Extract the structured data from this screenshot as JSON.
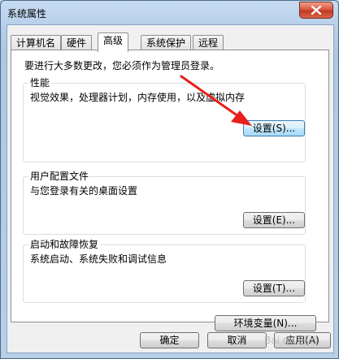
{
  "window": {
    "title": "系统属性"
  },
  "tabs": [
    {
      "label": "计算机名",
      "active": false
    },
    {
      "label": "硬件",
      "active": false
    },
    {
      "label": "高级",
      "active": true
    },
    {
      "label": "系统保护",
      "active": false
    },
    {
      "label": "远程",
      "active": false
    }
  ],
  "intro_text": "要进行大多数更改，您必须作为管理员登录。",
  "groups": {
    "performance": {
      "title": "性能",
      "description": "视觉效果，处理器计划，内存使用，以及虚拟内存",
      "button": "设置(S)..."
    },
    "user_profiles": {
      "title": "用户配置文件",
      "description": "与您登录有关的桌面设置",
      "button": "设置(E)..."
    },
    "startup_recovery": {
      "title": "启动和故障恢复",
      "description": "系统启动、系统失败和调试信息",
      "button": "设置(T)..."
    }
  },
  "env_button": "环境变量(N)...",
  "footer": {
    "ok": "确定",
    "cancel": "取消",
    "apply": "应用(A)"
  },
  "colors": {
    "annotation_arrow": "#e8201c",
    "close_button": "#c7432a"
  },
  "icons": {
    "close": "close-icon"
  }
}
